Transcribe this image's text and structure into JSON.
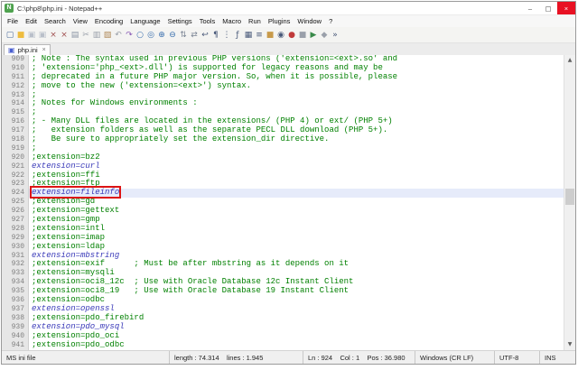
{
  "window": {
    "title": "C:\\php8\\php.ini - Notepad++",
    "logo_glyph": "N",
    "controls": {
      "minimize": "–",
      "maximize": "▢",
      "close": "×"
    }
  },
  "menu": {
    "items": [
      "File",
      "Edit",
      "Search",
      "View",
      "Encoding",
      "Language",
      "Settings",
      "Tools",
      "Macro",
      "Run",
      "Plugins",
      "Window",
      "?"
    ]
  },
  "toolbar": {
    "icons": [
      {
        "name": "new-file-icon",
        "glyph": "▢",
        "color": "#4a6b9a"
      },
      {
        "name": "open-file-icon",
        "glyph": "■",
        "color": "#eebc3e"
      },
      {
        "name": "save-icon",
        "glyph": "▣",
        "color": "#b9bfc9"
      },
      {
        "name": "save-all-icon",
        "glyph": "▣",
        "color": "#b9bfc9"
      },
      {
        "name": "close-file-icon",
        "glyph": "×",
        "color": "#a05050"
      },
      {
        "name": "close-all-icon",
        "glyph": "×",
        "color": "#a05050"
      },
      {
        "name": "print-icon",
        "glyph": "▤",
        "color": "#8a94a4"
      },
      {
        "name": "cut-icon",
        "glyph": "✂",
        "color": "#9aa0aa"
      },
      {
        "name": "copy-icon",
        "glyph": "▥",
        "color": "#9aa0aa"
      },
      {
        "name": "paste-icon",
        "glyph": "▧",
        "color": "#b08a5a"
      },
      {
        "name": "undo-icon",
        "glyph": "↶",
        "color": "#9aa0aa"
      },
      {
        "name": "redo-icon",
        "glyph": "↷",
        "color": "#8a5ab5"
      },
      {
        "name": "find-icon",
        "glyph": "○",
        "color": "#3a6fae"
      },
      {
        "name": "replace-icon",
        "glyph": "◎",
        "color": "#3a6fae"
      },
      {
        "name": "zoom-in-icon",
        "glyph": "⊕",
        "color": "#3a6fae"
      },
      {
        "name": "zoom-out-icon",
        "glyph": "⊖",
        "color": "#3a6fae"
      },
      {
        "name": "sync-vertical-icon",
        "glyph": "⇅",
        "color": "#7a8494"
      },
      {
        "name": "sync-horizontal-icon",
        "glyph": "⇄",
        "color": "#7a8494"
      },
      {
        "name": "word-wrap-icon",
        "glyph": "↩",
        "color": "#4a5a7a"
      },
      {
        "name": "show-all-chars-icon",
        "glyph": "¶",
        "color": "#4a5a7a"
      },
      {
        "name": "indent-guide-icon",
        "glyph": "⋮",
        "color": "#4a5a7a"
      },
      {
        "name": "function-list-icon",
        "glyph": "ƒ",
        "color": "#4a5a7a"
      },
      {
        "name": "document-map-icon",
        "glyph": "▦",
        "color": "#4a5a7a"
      },
      {
        "name": "document-list-icon",
        "glyph": "≡",
        "color": "#4a5a7a"
      },
      {
        "name": "folder-workspace-icon",
        "glyph": "■",
        "color": "#c89a4a"
      },
      {
        "name": "monitoring-icon",
        "glyph": "◉",
        "color": "#4a5a7a"
      },
      {
        "name": "record-macro-icon",
        "glyph": "●",
        "color": "#c03a3a"
      },
      {
        "name": "stop-macro-icon",
        "glyph": "■",
        "color": "#9aa0aa"
      },
      {
        "name": "play-macro-icon",
        "glyph": "▶",
        "color": "#3a8a4a"
      },
      {
        "name": "save-macro-icon",
        "glyph": "◆",
        "color": "#9aa0aa"
      },
      {
        "name": "run-macro-multi-icon",
        "glyph": "»",
        "color": "#4a5a7a"
      }
    ]
  },
  "tab": {
    "label": "php.ini",
    "icon_glyph": "▣",
    "close_glyph": "×"
  },
  "editor": {
    "lines": [
      {
        "num": 909,
        "text": "; Note : The syntax used in previous PHP versions ('extension=<ext>.so' and",
        "style": "comment"
      },
      {
        "num": 910,
        "text": "; 'extension='php_<ext>.dll') is supported for legacy reasons and may be",
        "style": "comment"
      },
      {
        "num": 911,
        "text": "; deprecated in a future PHP major version. So, when it is possible, please",
        "style": "comment"
      },
      {
        "num": 912,
        "text": "; move to the new ('extension=<ext>') syntax.",
        "style": "comment"
      },
      {
        "num": 913,
        "text": ";",
        "style": "comment"
      },
      {
        "num": 914,
        "text": "; Notes for Windows environments :",
        "style": "comment"
      },
      {
        "num": 915,
        "text": ";",
        "style": "comment"
      },
      {
        "num": 916,
        "text": "; - Many DLL files are located in the extensions/ (PHP 4) or ext/ (PHP 5+)",
        "style": "comment"
      },
      {
        "num": 917,
        "text": ";   extension folders as well as the separate PECL DLL download (PHP 5+).",
        "style": "comment"
      },
      {
        "num": 918,
        "text": ";   Be sure to appropriately set the extension_dir directive.",
        "style": "comment"
      },
      {
        "num": 919,
        "text": ";",
        "style": "comment"
      },
      {
        "num": 920,
        "text": ";extension=bz2",
        "style": "comment"
      },
      {
        "num": 921,
        "text": "extension=curl",
        "style": "directive"
      },
      {
        "num": 922,
        "text": ";extension=ffi",
        "style": "comment"
      },
      {
        "num": 923,
        "text": ";extension=ftp",
        "style": "comment"
      },
      {
        "num": 924,
        "text": "extension=fileinfo",
        "style": "directive",
        "highlight": true
      },
      {
        "num": 925,
        "text": ";extension=gd",
        "style": "comment"
      },
      {
        "num": 926,
        "text": ";extension=gettext",
        "style": "comment"
      },
      {
        "num": 927,
        "text": ";extension=gmp",
        "style": "comment"
      },
      {
        "num": 928,
        "text": ";extension=intl",
        "style": "comment"
      },
      {
        "num": 929,
        "text": ";extension=imap",
        "style": "comment"
      },
      {
        "num": 930,
        "text": ";extension=ldap",
        "style": "comment"
      },
      {
        "num": 931,
        "text": "extension=mbstring",
        "style": "directive"
      },
      {
        "num": 932,
        "text": ";extension=exif      ; Must be after mbstring as it depends on it",
        "style": "comment"
      },
      {
        "num": 933,
        "text": ";extension=mysqli",
        "style": "comment"
      },
      {
        "num": 934,
        "text": ";extension=oci8_12c  ; Use with Oracle Database 12c Instant Client",
        "style": "comment"
      },
      {
        "num": 935,
        "text": ";extension=oci8_19   ; Use with Oracle Database 19 Instant Client",
        "style": "comment"
      },
      {
        "num": 936,
        "text": ";extension=odbc",
        "style": "comment"
      },
      {
        "num": 937,
        "text": "extension=openssl",
        "style": "directive"
      },
      {
        "num": 938,
        "text": ";extension=pdo_firebird",
        "style": "comment"
      },
      {
        "num": 939,
        "text": "extension=pdo_mysql",
        "style": "directive"
      },
      {
        "num": 940,
        "text": ";extension=pdo_oci",
        "style": "comment"
      },
      {
        "num": 941,
        "text": ";extension=pdo_odbc",
        "style": "comment"
      }
    ]
  },
  "scrollbar": {
    "up_glyph": "▲",
    "down_glyph": "▼"
  },
  "status": {
    "doc_type": "MS ini file",
    "length_info": "length : 74.314    lines : 1.945",
    "position_info": "Ln : 924    Col : 1    Pos : 36.980",
    "eol": "Windows (CR LF)",
    "encoding": "UTF-8",
    "insert_mode": "INS"
  }
}
